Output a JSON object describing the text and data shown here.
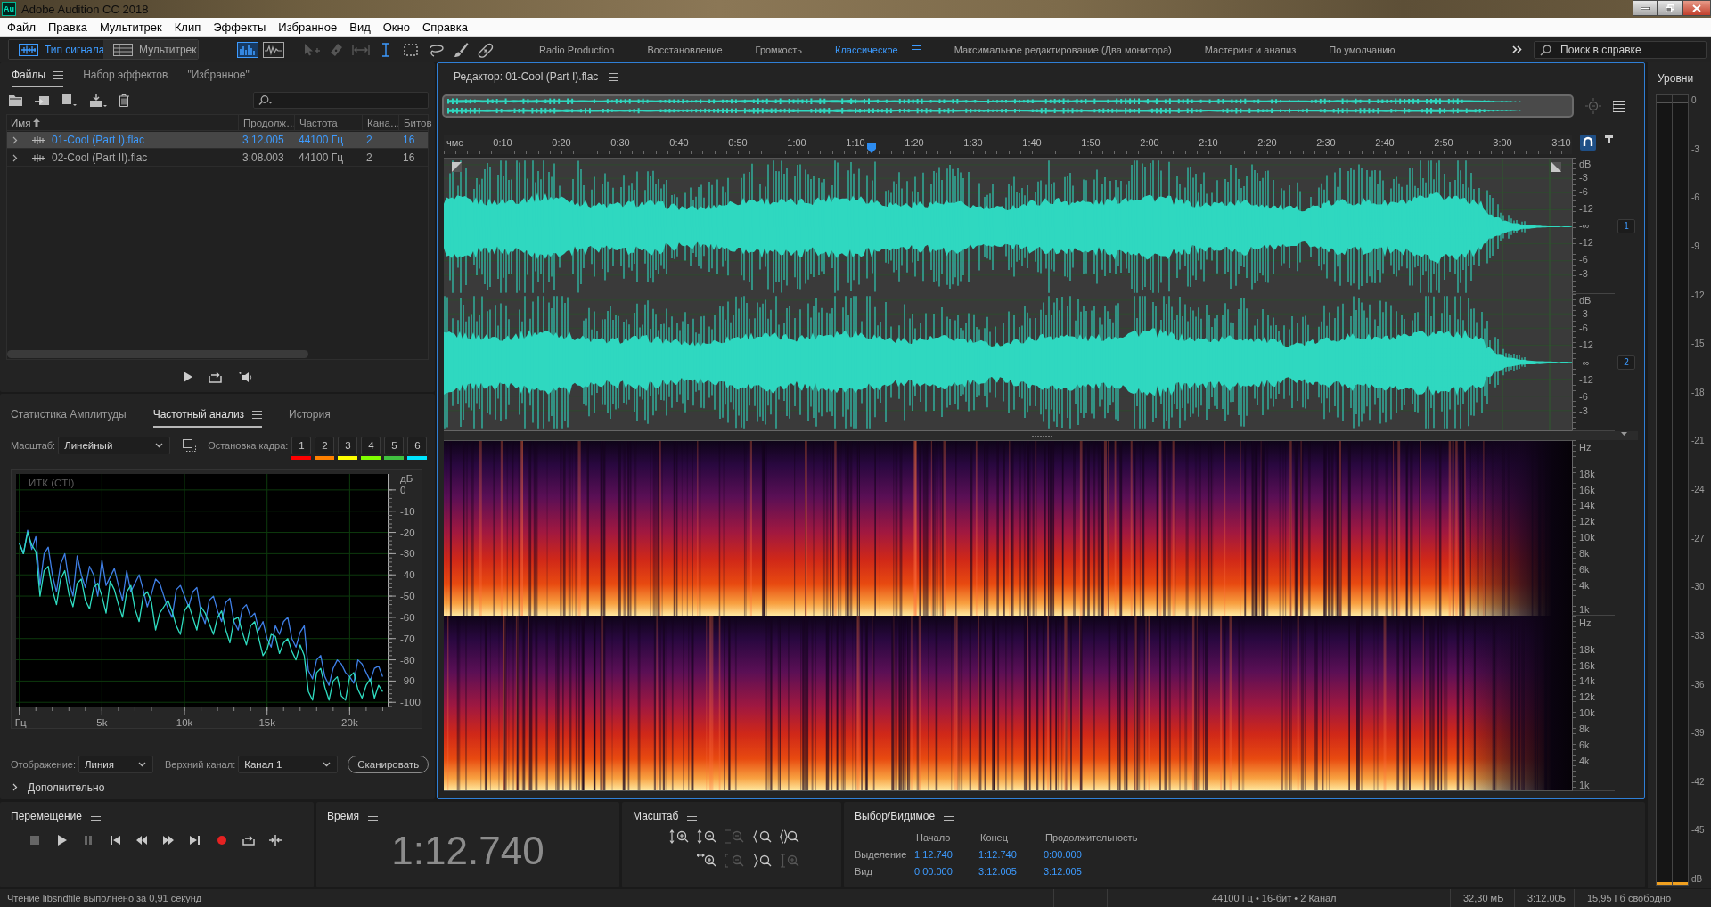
{
  "window": {
    "app_icon": "Au",
    "title": "Adobe Audition CC 2018"
  },
  "menu": [
    "Файл",
    "Правка",
    "Мультитрек",
    "Клип",
    "Эффекты",
    "Избранное",
    "Вид",
    "Окно",
    "Справка"
  ],
  "toolbar": {
    "modes": [
      {
        "kind": "waveform",
        "label": "Тип сигнала",
        "selected": true
      },
      {
        "kind": "multitrack",
        "label": "Мультитрек",
        "selected": false
      }
    ],
    "views": [
      {
        "kind": "spectral",
        "selected": true
      },
      {
        "kind": "pitch",
        "selected": false
      }
    ],
    "tools": [
      {
        "kind": "move",
        "selected": false,
        "disabled": true
      },
      {
        "kind": "razor",
        "selected": false,
        "disabled": true
      },
      {
        "kind": "slip",
        "selected": false,
        "disabled": true
      },
      {
        "kind": "time",
        "selected": true,
        "disabled": false
      },
      {
        "kind": "marquee",
        "selected": false,
        "disabled": false
      },
      {
        "kind": "lasso",
        "selected": false,
        "disabled": false
      },
      {
        "kind": "brush",
        "selected": false,
        "disabled": false
      },
      {
        "kind": "heal",
        "selected": false,
        "disabled": false
      }
    ],
    "workspaces": [
      {
        "label": "Radio Production",
        "selected": false
      },
      {
        "label": "Восстановление",
        "selected": false
      },
      {
        "label": "Громкость",
        "selected": false
      },
      {
        "label": "Классическое",
        "selected": true
      },
      {
        "label": "Максимальное редактирование (Два монитора)",
        "selected": false
      },
      {
        "label": "Мастеринг и анализ",
        "selected": false
      },
      {
        "label": "По умолчанию",
        "selected": false
      }
    ],
    "help_search": {
      "placeholder": "Поиск в справке"
    }
  },
  "files_panel": {
    "tabs": [
      {
        "label": "Файлы",
        "selected": true
      },
      {
        "label": "Набор эффектов",
        "selected": false
      },
      {
        "label": "\"Избранное\"",
        "selected": false
      }
    ],
    "columns": [
      {
        "label": "Имя",
        "sorted": true
      },
      {
        "label": "Продолж…",
        "sorted": false
      },
      {
        "label": "Частота",
        "sorted": false
      },
      {
        "label": "Кана…",
        "sorted": false
      },
      {
        "label": "Битов",
        "sorted": false
      }
    ],
    "rows": [
      {
        "name": "01-Cool (Part I).flac",
        "duration": "3:12.005",
        "rate": "44100 Гц",
        "channels": "2",
        "bits": "16",
        "selected": true,
        "expanded": false
      },
      {
        "name": "02-Cool (Part II).flac",
        "duration": "3:08.003",
        "rate": "44100 Гц",
        "channels": "2",
        "bits": "16",
        "selected": false,
        "expanded": false
      }
    ]
  },
  "freq_panel": {
    "tabs": [
      {
        "label": "Статистика Амплитуды",
        "selected": false
      },
      {
        "label": "Частотный анализ",
        "selected": true
      },
      {
        "label": "История",
        "selected": false
      }
    ],
    "scale": {
      "label": "Масштаб:",
      "value": "Линейный"
    },
    "freeze": {
      "label": "Остановка кадра:",
      "buttons": [
        {
          "label": "1",
          "color": "#ff0000"
        },
        {
          "label": "2",
          "color": "#ff8000"
        },
        {
          "label": "3",
          "color": "#ffff00"
        },
        {
          "label": "4",
          "color": "#80ff00"
        },
        {
          "label": "5",
          "color": "#40c040"
        },
        {
          "label": "6",
          "color": "#00e5ff"
        }
      ]
    },
    "chart_data": {
      "type": "line",
      "title": "ИТК (CTI)",
      "ylabel": "дБ",
      "grid": true,
      "x": [
        0,
        250,
        500,
        750,
        1000,
        1250,
        1500,
        1750,
        2000,
        2250,
        2500,
        2750,
        3000,
        3250,
        3500,
        3750,
        4000,
        4250,
        4500,
        4750,
        5000,
        5250,
        5500,
        5750,
        6000,
        6250,
        6500,
        6750,
        7000,
        7250,
        7500,
        7750,
        8000,
        8250,
        8500,
        8750,
        9000,
        9250,
        9500,
        9750,
        10000,
        10250,
        10500,
        10750,
        11000,
        11250,
        11500,
        11750,
        12000,
        12250,
        12500,
        12750,
        13000,
        13250,
        13500,
        13750,
        14000,
        14250,
        14500,
        14750,
        15000,
        15250,
        15500,
        15750,
        16000,
        16250,
        16500,
        16750,
        17000,
        17250,
        17500,
        17750,
        18000,
        18250,
        18500,
        18750,
        19000,
        19250,
        19500,
        19750,
        20000,
        20250,
        20500,
        20750,
        21000,
        21250,
        21500,
        21750,
        22000
      ],
      "series": [
        {
          "color": "#3f7fe6",
          "values": [
            -25,
            -30,
            -19,
            -28,
            -22,
            -45,
            -30,
            -27,
            -40,
            -48,
            -35,
            -30,
            -43,
            -50,
            -31,
            -40,
            -46,
            -36,
            -40,
            -50,
            -33,
            -45,
            -41,
            -37,
            -45,
            -52,
            -38,
            -48,
            -44,
            -40,
            -47,
            -55,
            -49,
            -42,
            -44,
            -50,
            -56,
            -60,
            -47,
            -45,
            -50,
            -55,
            -48,
            -46,
            -58,
            -63,
            -52,
            -50,
            -57,
            -62,
            -53,
            -51,
            -62,
            -66,
            -56,
            -54,
            -60,
            -58,
            -66,
            -62,
            -70,
            -74,
            -64,
            -68,
            -62,
            -60,
            -70,
            -74,
            -67,
            -64,
            -85,
            -89,
            -80,
            -78,
            -88,
            -92,
            -84,
            -80,
            -82,
            -86,
            -88,
            -91,
            -80,
            -82,
            -86,
            -90,
            -84,
            -83,
            -88
          ]
        },
        {
          "color": "#2fdcc0",
          "values": [
            -25,
            -30,
            -20,
            -26,
            -29,
            -50,
            -38,
            -36,
            -47,
            -54,
            -42,
            -38,
            -49,
            -55,
            -44,
            -42,
            -52,
            -56,
            -46,
            -44,
            -50,
            -58,
            -43,
            -47,
            -54,
            -60,
            -48,
            -45,
            -56,
            -62,
            -50,
            -48,
            -53,
            -66,
            -58,
            -55,
            -52,
            -57,
            -64,
            -68,
            -57,
            -54,
            -60,
            -66,
            -55,
            -58,
            -63,
            -68,
            -60,
            -57,
            -66,
            -72,
            -61,
            -60,
            -67,
            -73,
            -64,
            -62,
            -70,
            -78,
            -75,
            -68,
            -69,
            -77,
            -72,
            -70,
            -76,
            -80,
            -73,
            -78,
            -95,
            -99,
            -86,
            -84,
            -93,
            -99,
            -90,
            -88,
            -97,
            -99,
            -88,
            -86,
            -94,
            -98,
            -92,
            -89,
            -98,
            -92,
            -95
          ]
        }
      ],
      "xlim": [
        -200,
        22300
      ],
      "ylim": [
        -102,
        7.5
      ],
      "xticks": [
        {
          "value": 0,
          "label": "Гц"
        },
        {
          "value": 5000,
          "label": "5k"
        },
        {
          "value": 10000,
          "label": "10k"
        },
        {
          "value": 15000,
          "label": "15k"
        },
        {
          "value": 20000,
          "label": "20k"
        }
      ],
      "yticks": [
        0,
        -10,
        -20,
        -30,
        -40,
        -50,
        -60,
        -70,
        -80,
        -90,
        -100
      ]
    },
    "display": {
      "label": "Отображение:",
      "value": "Линия"
    },
    "top_channel": {
      "label": "Верхний канал:",
      "value": "Канал 1"
    },
    "scan_button": "Сканировать",
    "advanced": {
      "label": "Дополнительно",
      "expanded": false
    }
  },
  "editor": {
    "title": "Редактор: 01-Cool (Part I).flac",
    "ruler": [
      "чмс",
      "0:10",
      "0:20",
      "0:30",
      "0:40",
      "0:50",
      "1:00",
      "1:10",
      "1:20",
      "1:30",
      "1:40",
      "1:50",
      "2:00",
      "2:10",
      "2:20",
      "2:30",
      "2:40",
      "2:50",
      "3:00",
      "3:10"
    ],
    "waveform_channels": [
      {
        "badge": "1",
        "scale": [
          "dB",
          "-3",
          "-6",
          "-12",
          "-∞",
          "-12",
          "-6",
          "-3"
        ]
      },
      {
        "badge": "2",
        "scale": [
          "dB",
          "-3",
          "-6",
          "-12",
          "-∞",
          "-12",
          "-6",
          "-3"
        ]
      }
    ],
    "spectral_channels": [
      {
        "scale": [
          "Hz",
          "18k",
          "16k",
          "14k",
          "12k",
          "10k",
          "8k",
          "6k",
          "4k",
          "1k"
        ]
      },
      {
        "scale": [
          "Hz",
          "18k",
          "16k",
          "14k",
          "12k",
          "10k",
          "8k",
          "6k",
          "4k",
          "1k"
        ]
      }
    ]
  },
  "levels": {
    "title": "Уровни",
    "scale": [
      "0",
      "-3",
      "-6",
      "-9",
      "-12",
      "-15",
      "-18",
      "-21",
      "-24",
      "-27",
      "-30",
      "-33",
      "-36",
      "-39",
      "-42",
      "-45",
      "dB"
    ],
    "meters": [
      {
        "level": 0.003
      },
      {
        "level": 0.003
      }
    ]
  },
  "transport": {
    "title": "Перемещение",
    "buttons": [
      {
        "kind": "stop",
        "disabled": true
      },
      {
        "kind": "play",
        "disabled": false
      },
      {
        "kind": "pause",
        "disabled": true
      },
      {
        "kind": "start",
        "disabled": false
      },
      {
        "kind": "rewind",
        "disabled": false
      },
      {
        "kind": "forward",
        "disabled": false
      },
      {
        "kind": "end",
        "disabled": false
      },
      {
        "kind": "record",
        "disabled": false
      },
      {
        "kind": "loop",
        "disabled": false
      },
      {
        "kind": "skip",
        "disabled": false
      }
    ]
  },
  "time": {
    "title": "Время",
    "value": "1:12.740"
  },
  "zoom": {
    "title": "Масштаб",
    "buttons": [
      {
        "kind": "amp-in",
        "disabled": false
      },
      {
        "kind": "amp-out",
        "disabled": false
      },
      {
        "kind": "out-full",
        "disabled": true
      },
      {
        "kind": "in-start",
        "disabled": false
      },
      {
        "kind": "in-sel",
        "disabled": false
      },
      {
        "kind": "time-in",
        "disabled": false
      },
      {
        "kind": "out-all",
        "disabled": true
      },
      {
        "kind": "in-end",
        "disabled": false
      },
      {
        "kind": "amp-sel",
        "disabled": true
      }
    ]
  },
  "selection": {
    "title": "Выбор/Видимое",
    "headers": [
      "Начало",
      "Конец",
      "Продолжительность"
    ],
    "rows": [
      {
        "label": "Выделение",
        "values": [
          "1:12.740",
          "1:12.740",
          "0:00.000"
        ]
      },
      {
        "label": "Вид",
        "values": [
          "0:00.000",
          "3:12.005",
          "3:12.005"
        ]
      }
    ]
  },
  "status": {
    "message": "Чтение libsndfile выполнено за 0,91 секунд",
    "fields": [
      "44100 Гц • 16-бит • 2 Канал",
      "32,30 мБ",
      "3:12.005",
      "15,95 Гб свободно"
    ]
  }
}
